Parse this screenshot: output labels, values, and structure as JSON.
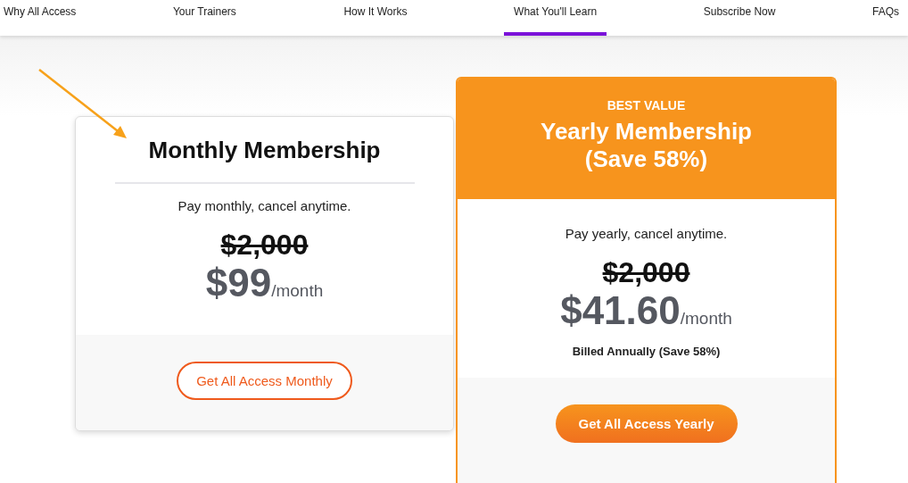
{
  "nav": [
    {
      "label": "Why All Access",
      "selected": false
    },
    {
      "label": "Your Trainers",
      "selected": false
    },
    {
      "label": "How It Works",
      "selected": false
    },
    {
      "label": "What You'll Learn",
      "selected": true
    },
    {
      "label": "Subscribe Now",
      "selected": false
    },
    {
      "label": "FAQs",
      "selected": false
    }
  ],
  "plans": [
    {
      "kind": "standard",
      "title": "Monthly Membership",
      "description": "Pay monthly, cancel anytime.",
      "old_price": "$2,000",
      "price": "$99",
      "period": "/month",
      "button": {
        "label": "Get All Access Monthly",
        "kind": "outline"
      }
    },
    {
      "kind": "featured",
      "badge": "BEST VALUE",
      "title": "Yearly Membership (Save 58%)",
      "description": "Pay yearly, cancel anytime.",
      "old_price": "$2,000",
      "price": "$41.60",
      "period": "/month",
      "note": "Billed Annually (Save 58%)",
      "button": {
        "label": "Get All Access Yearly",
        "kind": "filled"
      }
    }
  ]
}
